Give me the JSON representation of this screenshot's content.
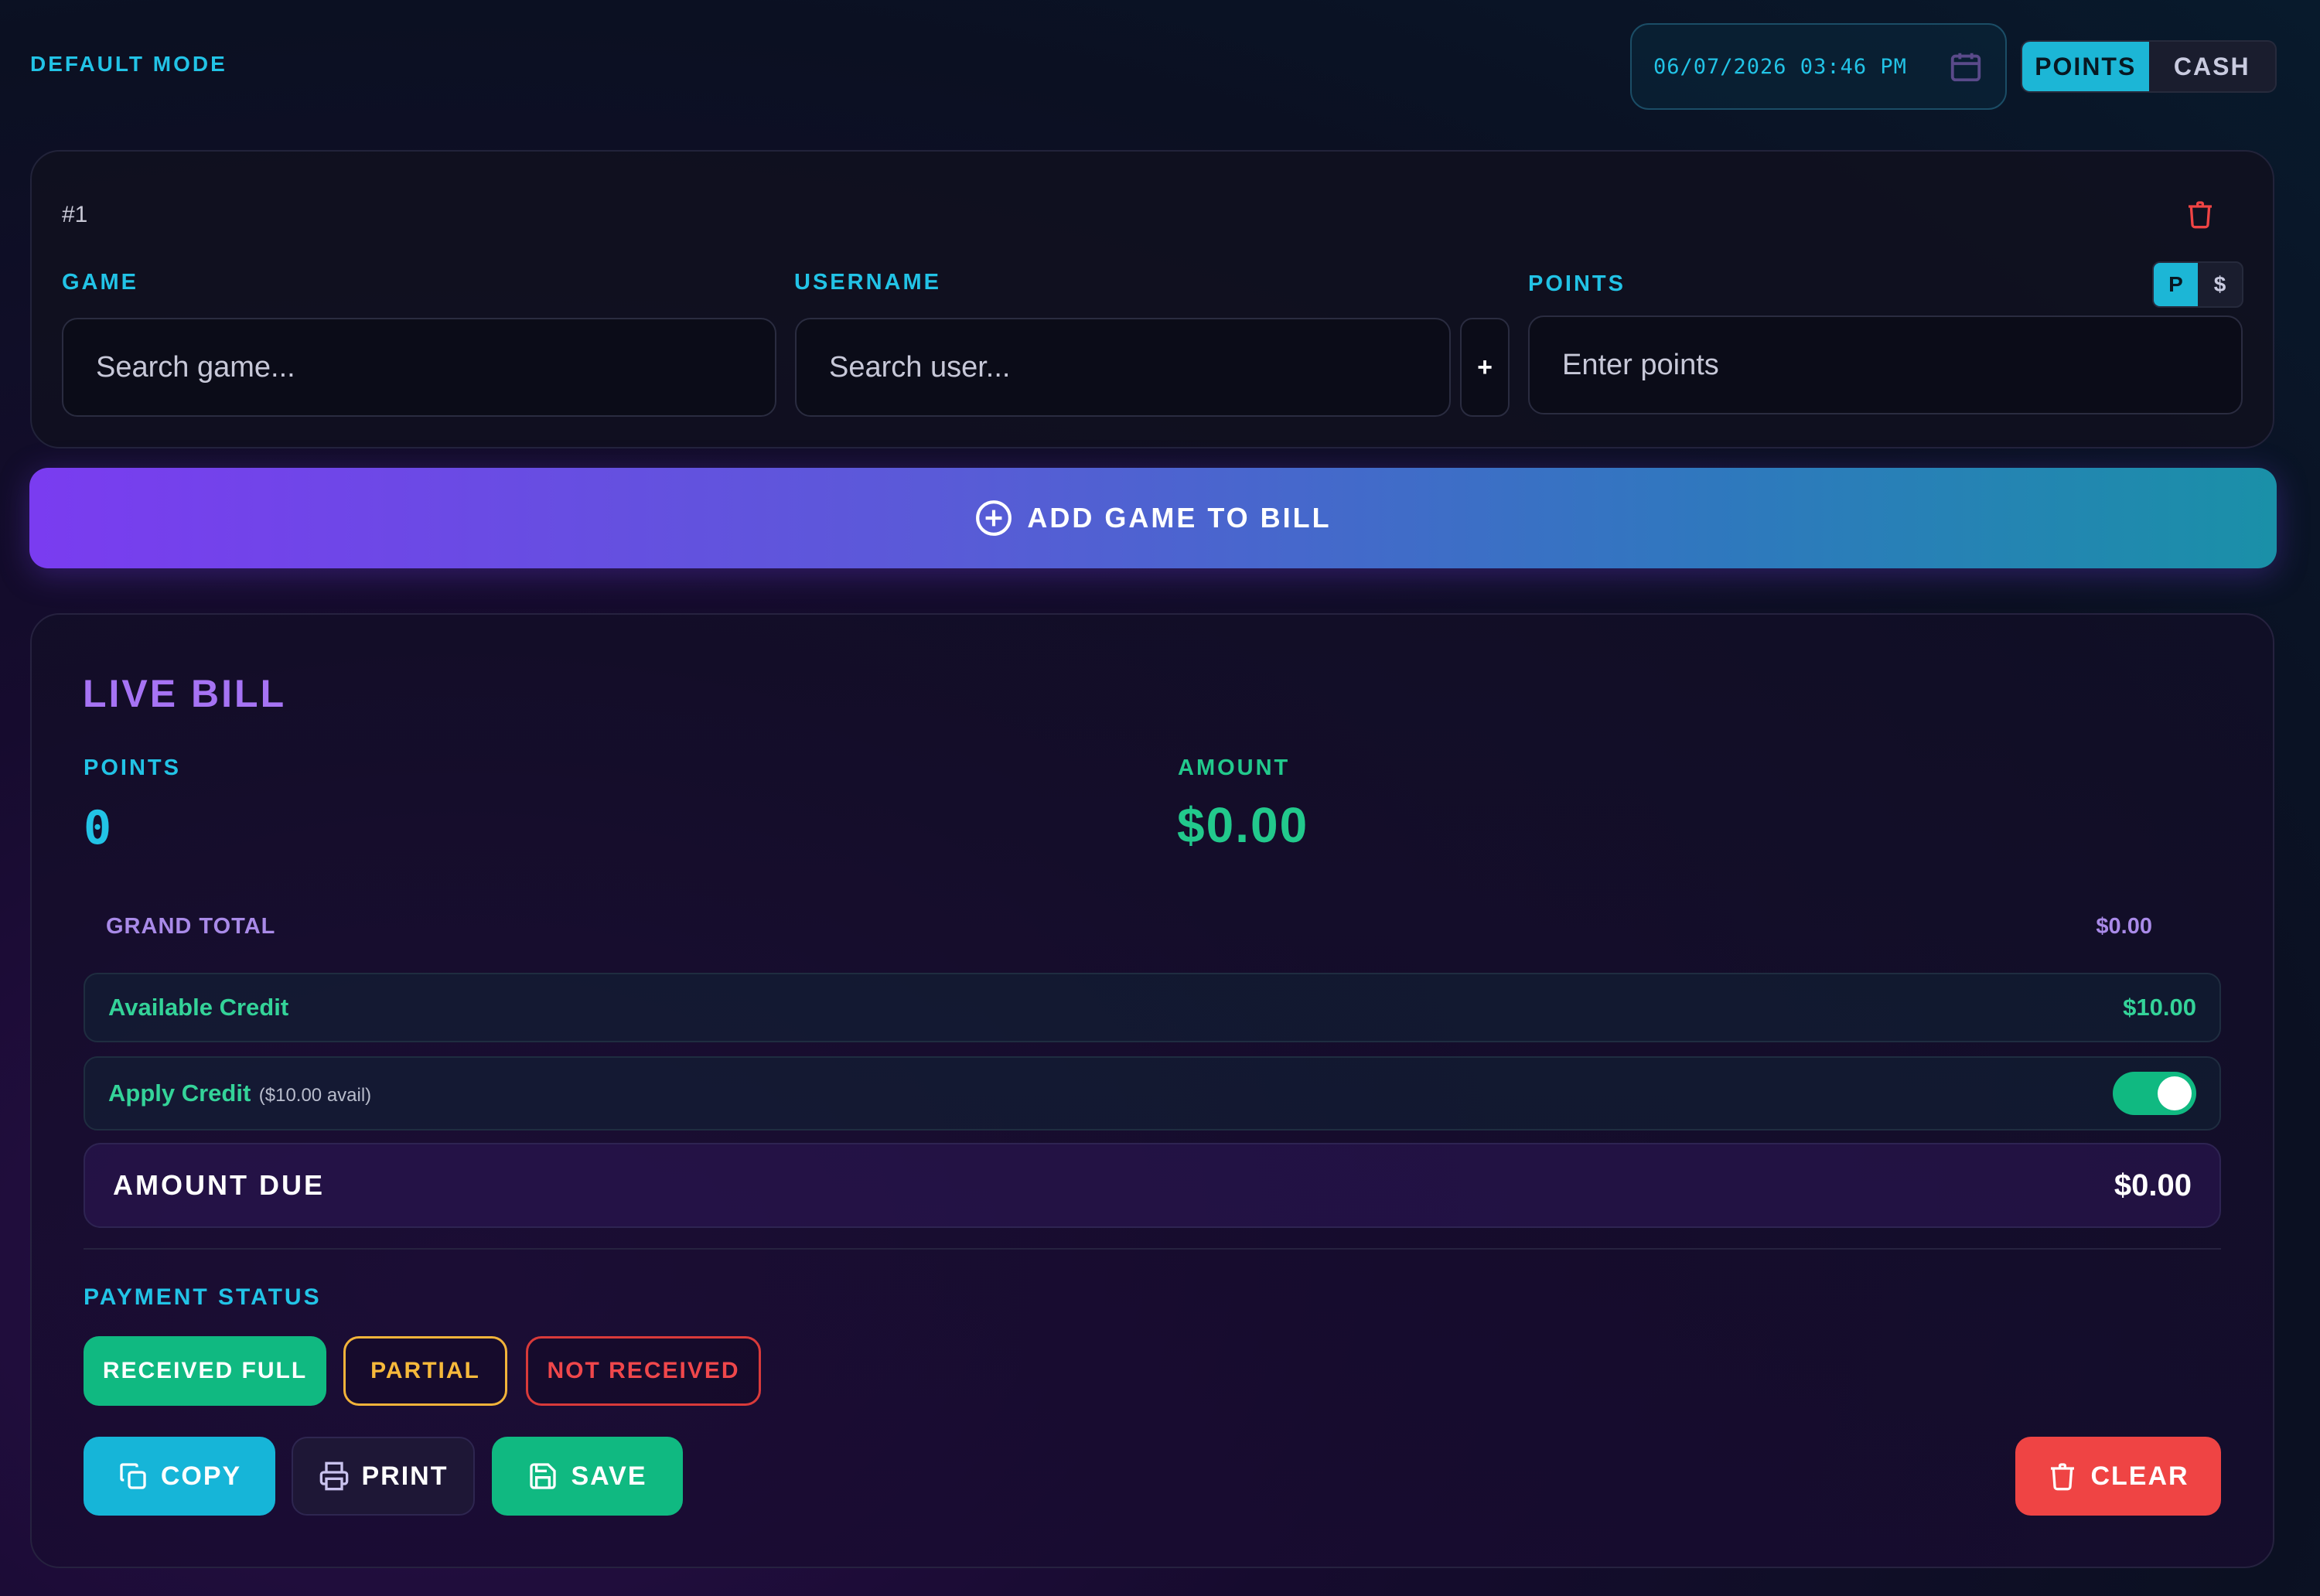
{
  "header": {
    "mode_label": "DEFAULT MODE",
    "datetime": "06/07/2026 03:46 PM",
    "calendar_icon": "calendar-icon",
    "mode_toggle": {
      "points": "POINTS",
      "cash": "CASH",
      "selected": "POINTS"
    }
  },
  "game_card": {
    "number": "#1",
    "delete_icon": "trash-icon",
    "game": {
      "label": "GAME",
      "placeholder": "Search game..."
    },
    "username": {
      "label": "USERNAME",
      "placeholder": "Search user..."
    },
    "add_user_label": "+",
    "points": {
      "label": "POINTS",
      "placeholder": "Enter points"
    },
    "unit_toggle": {
      "p": "P",
      "dollar": "$",
      "selected": "P"
    }
  },
  "add_button": {
    "label": "ADD GAME TO BILL",
    "icon": "plus-circle-icon"
  },
  "bill": {
    "title": "LIVE BILL",
    "points_label": "POINTS",
    "points_value": "0",
    "amount_label": "AMOUNT",
    "amount_value": "$0.00",
    "grand_total_label": "GRAND TOTAL",
    "grand_total_value": "$0.00",
    "available_credit_label": "Available Credit",
    "available_credit_value": "$10.00",
    "apply_credit_label": "Apply Credit",
    "apply_credit_sub": "($10.00 avail)",
    "apply_credit_on": true,
    "amount_due_label": "AMOUNT DUE",
    "amount_due_value": "$0.00"
  },
  "payment_status": {
    "title": "PAYMENT STATUS",
    "options": [
      "RECEIVED FULL",
      "PARTIAL",
      "NOT RECEIVED"
    ],
    "selected": "RECEIVED FULL"
  },
  "actions": {
    "copy": "COPY",
    "print": "PRINT",
    "save": "SAVE",
    "clear": "CLEAR"
  },
  "colors": {
    "accent_cyan": "#22c3e6",
    "accent_green": "#10b981",
    "accent_purple": "#a673f4",
    "danger": "#ef4444",
    "warning": "#f2b33a"
  }
}
